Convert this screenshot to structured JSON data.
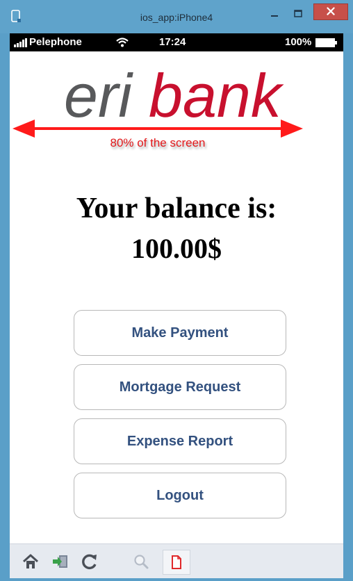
{
  "window": {
    "title": "ios_app:iPhone4",
    "close_glyph": "×"
  },
  "status_bar": {
    "carrier": "Pelephone",
    "time": "17:24",
    "battery": "100%"
  },
  "logo": {
    "part1": "eri",
    "part2": "bank",
    "part1_color": "#58595b",
    "part2_color": "#c8102e"
  },
  "annotation": {
    "caption": "80% of the screen",
    "color": "#e3191b"
  },
  "balance": {
    "title": "Your balance is:",
    "value": "100.00$"
  },
  "buttons": {
    "make_payment": "Make Payment",
    "mortgage_request": "Mortgage Request",
    "expense_report": "Expense Report",
    "logout": "Logout"
  },
  "toolbar": {
    "icons": [
      "home-icon",
      "install-icon",
      "refresh-icon",
      "search-icon",
      "document-icon"
    ]
  }
}
